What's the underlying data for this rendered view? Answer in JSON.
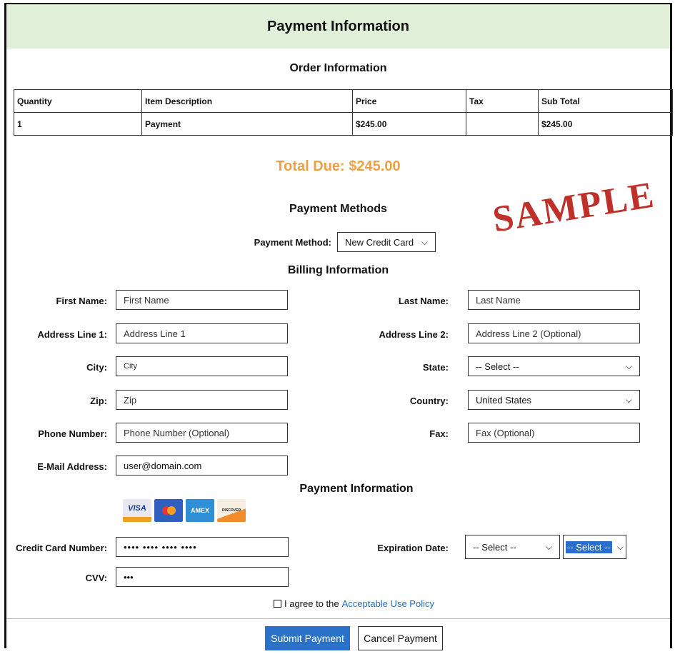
{
  "header": {
    "title": "Payment Information"
  },
  "order": {
    "title": "Order Information",
    "columns": [
      "Quantity",
      "Item Description",
      "Price",
      "Tax",
      "Sub Total"
    ],
    "rows": [
      [
        "1",
        "Payment",
        "$245.00",
        "",
        "$245.00"
      ]
    ]
  },
  "total": {
    "text": "Total Due: $245.00"
  },
  "stamp": "SAMPLE",
  "payment_methods": {
    "title": "Payment Methods",
    "label": "Payment Method:",
    "value": "New Credit Card"
  },
  "billing": {
    "title": "Billing Information",
    "first_name": {
      "label": "First Name:",
      "placeholder": "First Name"
    },
    "last_name": {
      "label": "Last Name:",
      "placeholder": "Last Name"
    },
    "address1": {
      "label": "Address Line 1:",
      "placeholder": "Address Line 1"
    },
    "address2": {
      "label": "Address Line 2:",
      "placeholder": "Address Line 2 (Optional)"
    },
    "city": {
      "label": "City:",
      "placeholder": "City"
    },
    "state": {
      "label": "State:",
      "value": "-- Select --"
    },
    "zip": {
      "label": "Zip:",
      "placeholder": "Zip"
    },
    "country": {
      "label": "Country:",
      "value": "United States"
    },
    "phone": {
      "label": "Phone Number:",
      "placeholder": "Phone Number (Optional)"
    },
    "fax": {
      "label": "Fax:",
      "placeholder": "Fax (Optional)"
    },
    "email": {
      "label": "E-Mail Address:",
      "value": "user@domain.com"
    }
  },
  "payment": {
    "title": "Payment Information",
    "cards": [
      "VISA",
      "",
      "AMEX",
      "DISCOVER"
    ],
    "card_number": {
      "label": "Credit Card Number:",
      "value": "•••• •••• •••• ••••"
    },
    "expiration": {
      "label": "Expiration Date:",
      "month": "-- Select --",
      "year": "-- Select --"
    },
    "cvv": {
      "label": "CVV:",
      "value": "•••"
    }
  },
  "agree": {
    "prefix": "I agree to the",
    "link": "Acceptable Use Policy"
  },
  "buttons": {
    "submit": "Submit Payment",
    "cancel": "Cancel Payment"
  },
  "colors": {
    "header_bg": "#dfefd8",
    "total": "#f0a040",
    "stamp": "#c0302a",
    "primary": "#1b6fc0"
  }
}
